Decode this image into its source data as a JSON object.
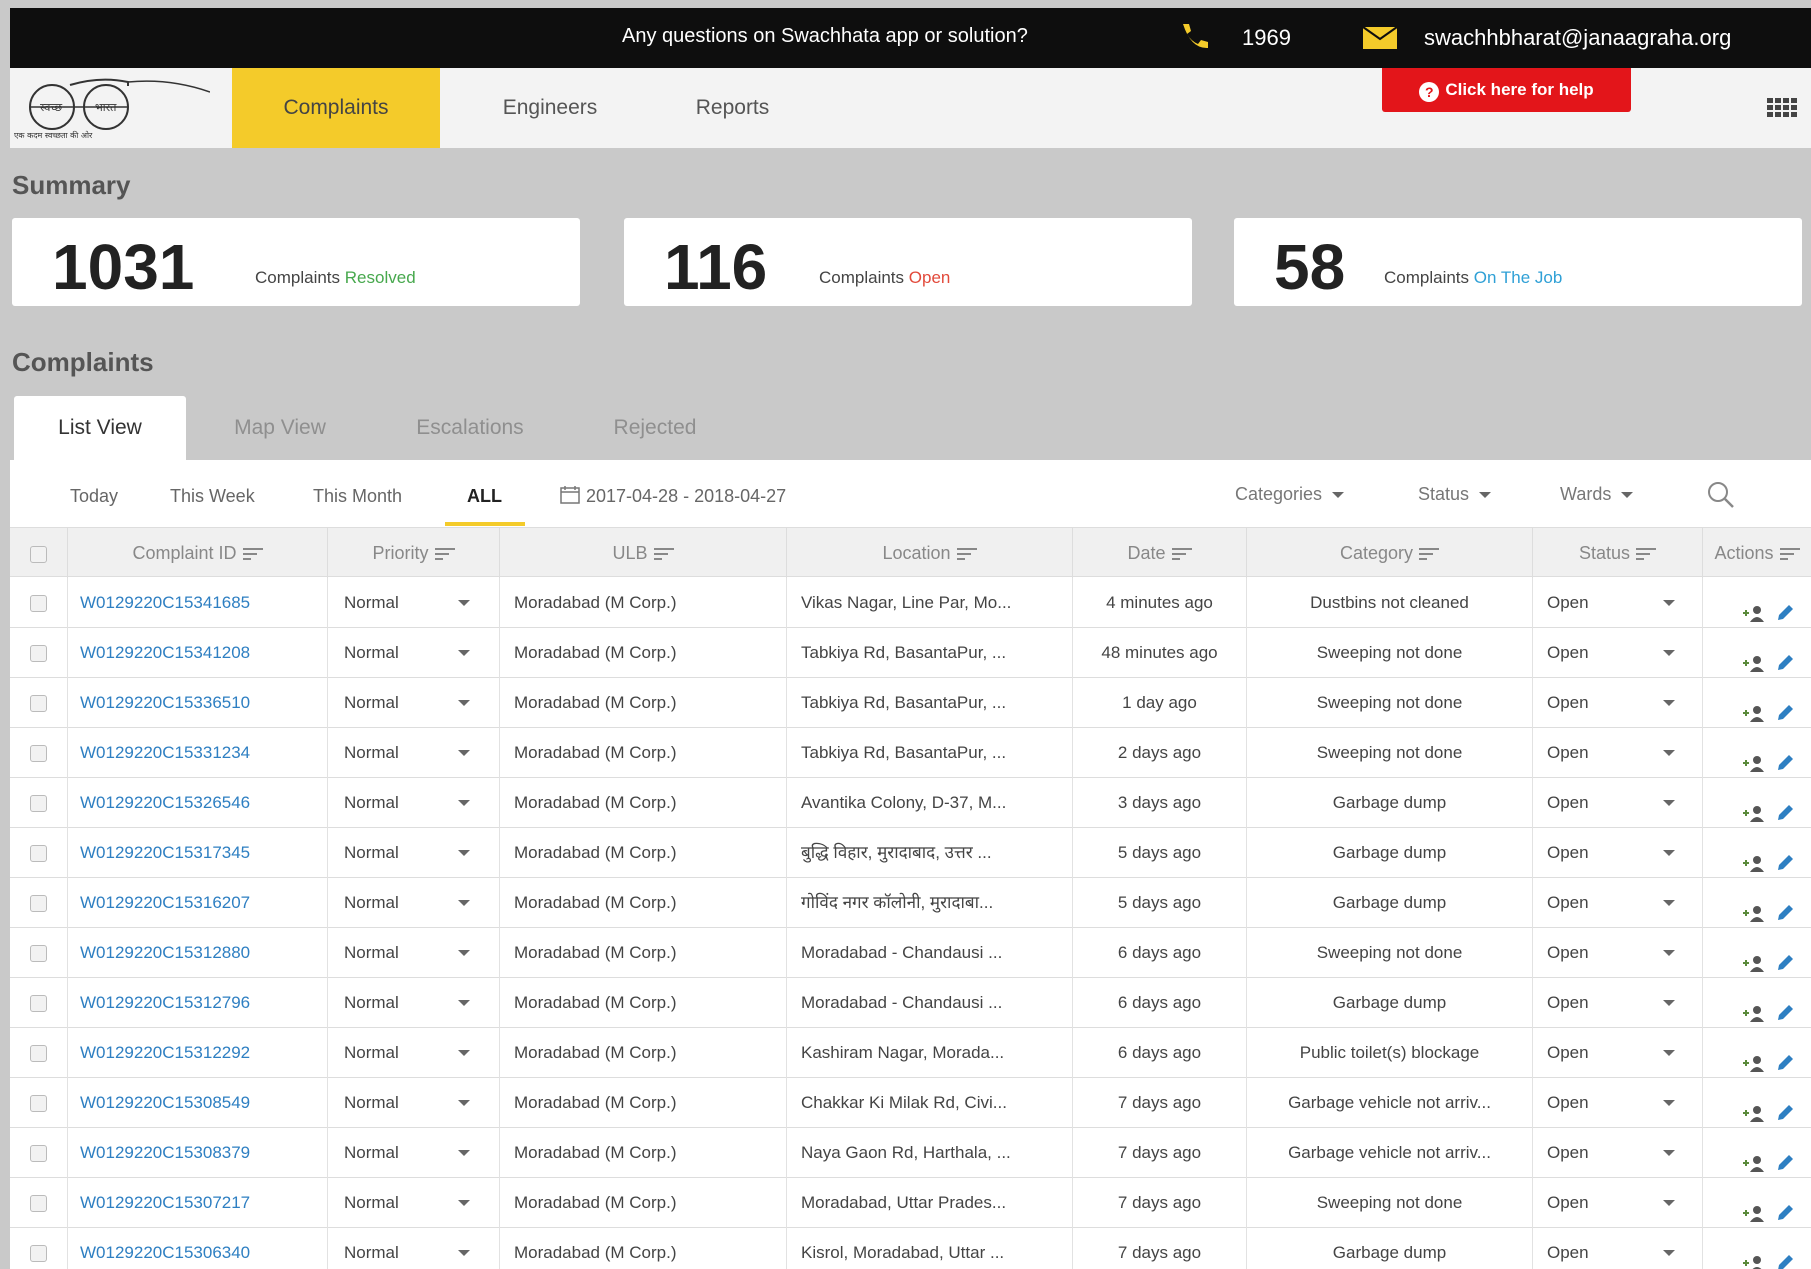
{
  "topbar": {
    "question": "Any questions on Swachhata app or solution?",
    "phone": "1969",
    "email": "swachhbharat@janaagraha.org"
  },
  "logo": {
    "left_word": "स्वच्छ",
    "right_word": "भारत",
    "tagline": "एक कदम स्वच्छता की ओर"
  },
  "nav": {
    "items": [
      "Complaints",
      "Engineers",
      "Reports"
    ],
    "help": "Click here for help"
  },
  "summary": {
    "title": "Summary",
    "cards": [
      {
        "count": "1031",
        "label": "Complaints",
        "status": "Resolved"
      },
      {
        "count": "116",
        "label": "Complaints",
        "status": "Open"
      },
      {
        "count": "58",
        "label": "Complaints",
        "status": "On The Job"
      }
    ]
  },
  "complaints": {
    "title": "Complaints",
    "tabs": [
      "List View",
      "Map View",
      "Escalations",
      "Rejected"
    ],
    "filters": [
      "Today",
      "This Week",
      "This Month",
      "ALL"
    ],
    "date_range": "2017-04-28 - 2018-04-27",
    "dropdowns": [
      "Categories",
      "Status",
      "Wards"
    ],
    "columns": [
      "Complaint ID",
      "Priority",
      "ULB",
      "Location",
      "Date",
      "Category",
      "Status",
      "Actions"
    ],
    "rows": [
      {
        "id": "W0129220C15341685",
        "priority": "Normal",
        "ulb": "Moradabad (M Corp.)",
        "location": "Vikas Nagar, Line Par, Mo...",
        "date": "4 minutes ago",
        "category": "Dustbins not cleaned",
        "status": "Open"
      },
      {
        "id": "W0129220C15341208",
        "priority": "Normal",
        "ulb": "Moradabad (M Corp.)",
        "location": "Tabkiya Rd, BasantaPur, ...",
        "date": "48 minutes ago",
        "category": "Sweeping not done",
        "status": "Open"
      },
      {
        "id": "W0129220C15336510",
        "priority": "Normal",
        "ulb": "Moradabad (M Corp.)",
        "location": "Tabkiya Rd, BasantaPur, ...",
        "date": "1 day ago",
        "category": "Sweeping not done",
        "status": "Open"
      },
      {
        "id": "W0129220C15331234",
        "priority": "Normal",
        "ulb": "Moradabad (M Corp.)",
        "location": "Tabkiya Rd, BasantaPur, ...",
        "date": "2 days ago",
        "category": "Sweeping not done",
        "status": "Open"
      },
      {
        "id": "W0129220C15326546",
        "priority": "Normal",
        "ulb": "Moradabad (M Corp.)",
        "location": "Avantika Colony, D-37, M...",
        "date": "3 days ago",
        "category": "Garbage dump",
        "status": "Open"
      },
      {
        "id": "W0129220C15317345",
        "priority": "Normal",
        "ulb": "Moradabad (M Corp.)",
        "location": "बुद्धि विहार, मुरादाबाद, उत्तर ...",
        "date": "5 days ago",
        "category": "Garbage dump",
        "status": "Open"
      },
      {
        "id": "W0129220C15316207",
        "priority": "Normal",
        "ulb": "Moradabad (M Corp.)",
        "location": "गोविंद नगर कॉलोनी, मुरादाबा...",
        "date": "5 days ago",
        "category": "Garbage dump",
        "status": "Open"
      },
      {
        "id": "W0129220C15312880",
        "priority": "Normal",
        "ulb": "Moradabad (M Corp.)",
        "location": "Moradabad - Chandausi ...",
        "date": "6 days ago",
        "category": "Sweeping not done",
        "status": "Open"
      },
      {
        "id": "W0129220C15312796",
        "priority": "Normal",
        "ulb": "Moradabad (M Corp.)",
        "location": "Moradabad - Chandausi ...",
        "date": "6 days ago",
        "category": "Garbage dump",
        "status": "Open"
      },
      {
        "id": "W0129220C15312292",
        "priority": "Normal",
        "ulb": "Moradabad (M Corp.)",
        "location": "Kashiram Nagar, Morada...",
        "date": "6 days ago",
        "category": "Public toilet(s) blockage",
        "status": "Open"
      },
      {
        "id": "W0129220C15308549",
        "priority": "Normal",
        "ulb": "Moradabad (M Corp.)",
        "location": "Chakkar Ki Milak Rd, Civi...",
        "date": "7 days ago",
        "category": "Garbage vehicle not arriv...",
        "status": "Open"
      },
      {
        "id": "W0129220C15308379",
        "priority": "Normal",
        "ulb": "Moradabad (M Corp.)",
        "location": "Naya Gaon Rd, Harthala, ...",
        "date": "7 days ago",
        "category": "Garbage vehicle not arriv...",
        "status": "Open"
      },
      {
        "id": "W0129220C15307217",
        "priority": "Normal",
        "ulb": "Moradabad (M Corp.)",
        "location": "Moradabad, Uttar Prades...",
        "date": "7 days ago",
        "category": "Sweeping not done",
        "status": "Open"
      },
      {
        "id": "W0129220C15306340",
        "priority": "Normal",
        "ulb": "Moradabad (M Corp.)",
        "location": "Kisrol, Moradabad, Uttar ...",
        "date": "7 days ago",
        "category": "Garbage dump",
        "status": "Open"
      }
    ]
  },
  "colors": {
    "accent": "#f4cb2a",
    "help_button": "#e3151a",
    "resolved": "#47a84d",
    "open": "#e24a3b",
    "on_the_job": "#2fa0d6",
    "link": "#2e7fc2"
  }
}
